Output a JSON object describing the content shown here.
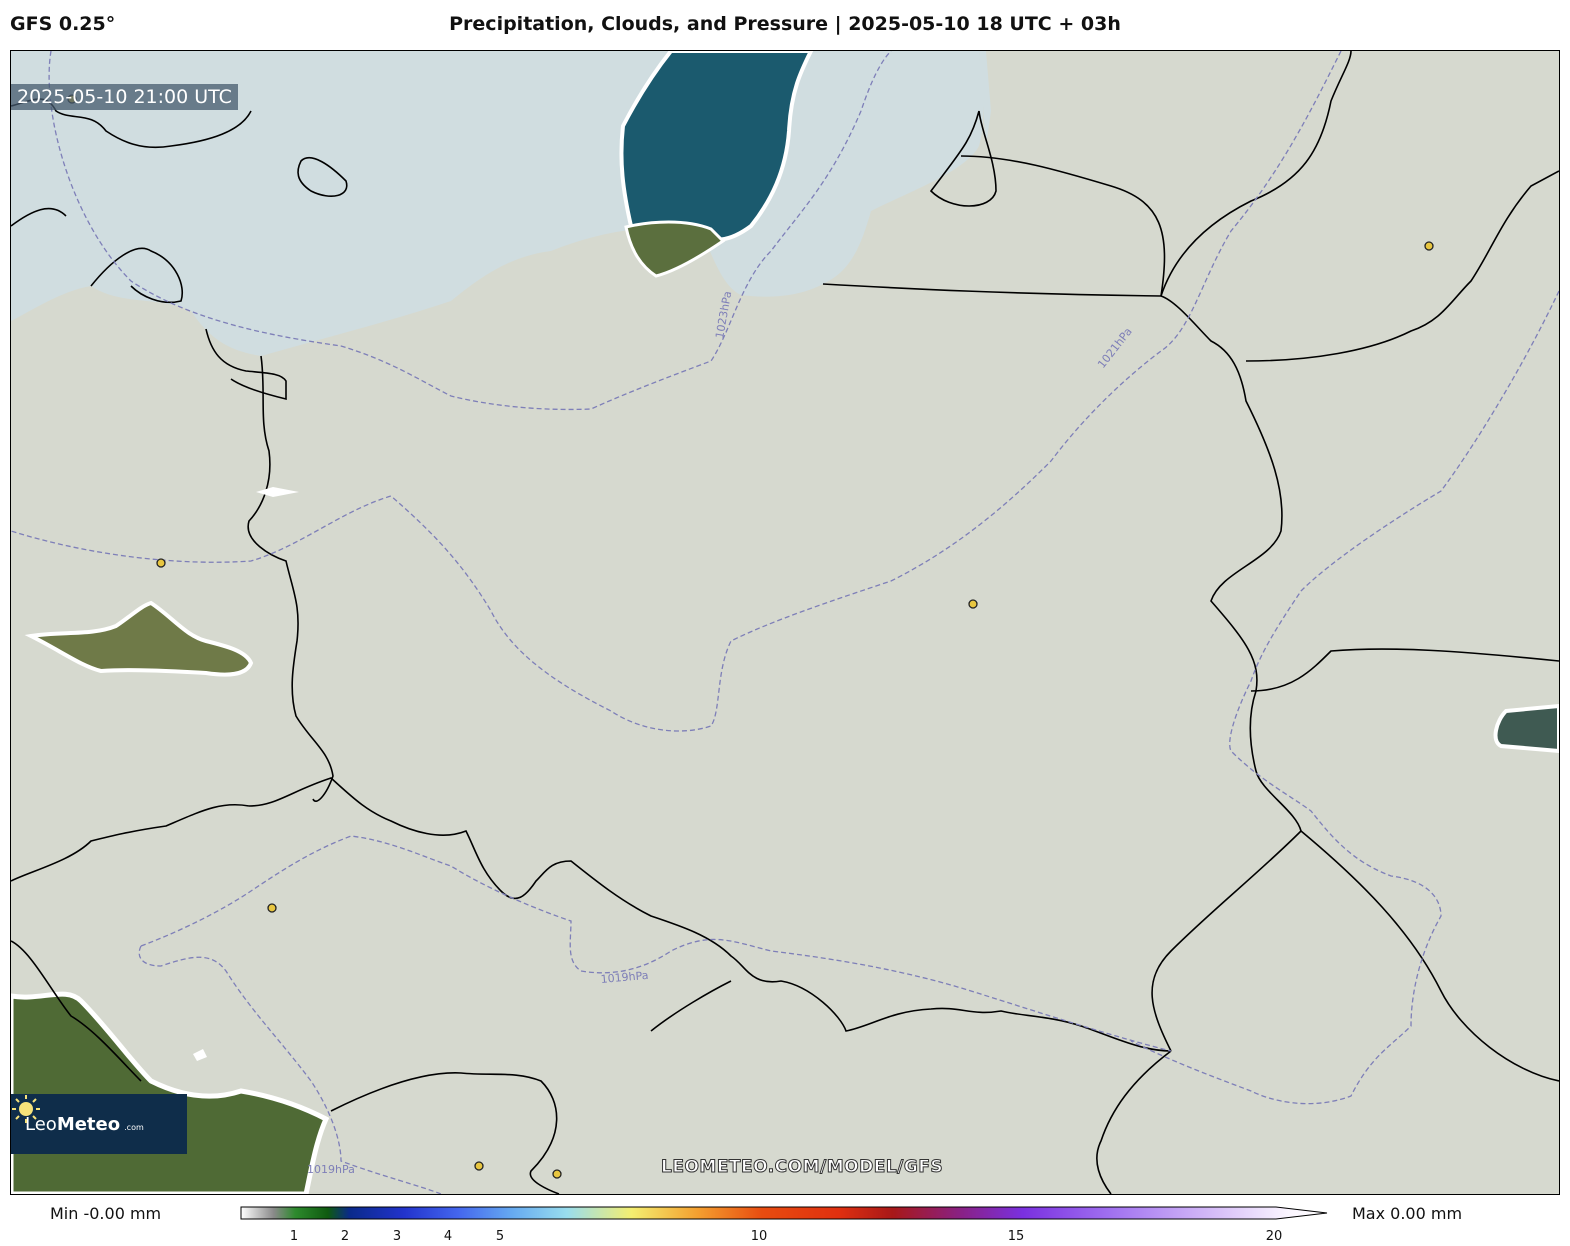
{
  "header": {
    "model": "GFS 0.25°",
    "title": "Precipitation, Clouds, and Pressure | 2025-05-10 18 UTC + 03h"
  },
  "map": {
    "valid_time": "2025-05-10 21:00 UTC",
    "watermark": "LEOMETEO.COM/MODEL/GFS",
    "logo": {
      "brand_light": "Leo",
      "brand_bold": "Meteo",
      "domain": ".com"
    },
    "isobar_labels": [
      "1023hPa",
      "1021hPa",
      "1019hPa",
      "1019hPa"
    ],
    "colors": {
      "sea": "#d0dde0",
      "land": "#d6d9cf",
      "cloud_dark": "#1b5a6e",
      "isobar": "#7e7fb8",
      "border": "#000000",
      "city": "#e8c640"
    }
  },
  "colorbar": {
    "min_label": "Min -0.00 mm",
    "max_label": "Max 0.00 mm",
    "ticks": [
      "1",
      "2",
      "3",
      "4",
      "5",
      "10",
      "15",
      "20"
    ],
    "unit": "mm"
  }
}
